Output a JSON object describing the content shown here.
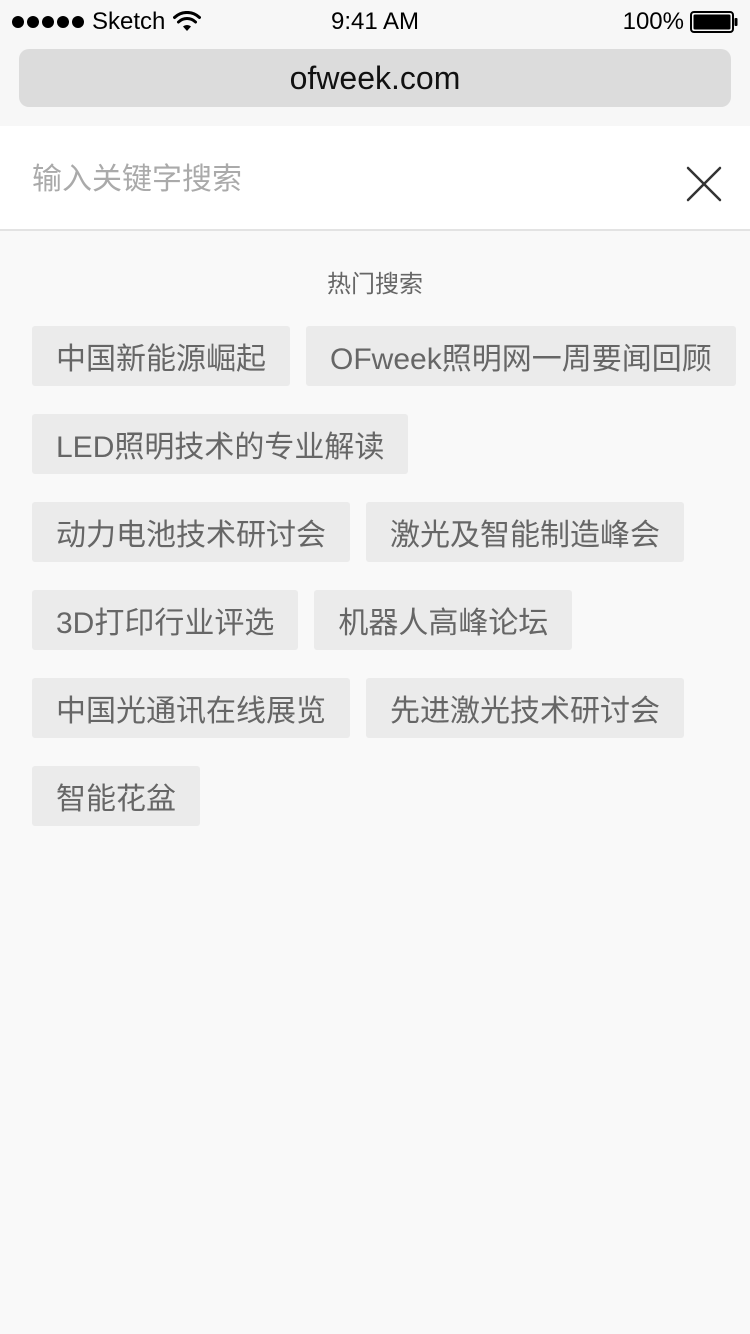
{
  "status_bar": {
    "carrier": "Sketch",
    "time": "9:41 AM",
    "battery": "100%"
  },
  "browser": {
    "url": "ofweek.com"
  },
  "search": {
    "placeholder": "输入关键字搜索",
    "value": ""
  },
  "hot_search": {
    "title": "热门搜索",
    "tags": [
      "中国新能源崛起",
      "OFweek照明网一周要闻回顾",
      "LED照明技术的专业解读",
      "动力电池技术研讨会",
      "激光及智能制造峰会",
      "3D打印行业评选",
      "机器人高峰论坛",
      "中国光通讯在线展览",
      "先进激光技术研讨会",
      "智能花盆"
    ]
  }
}
